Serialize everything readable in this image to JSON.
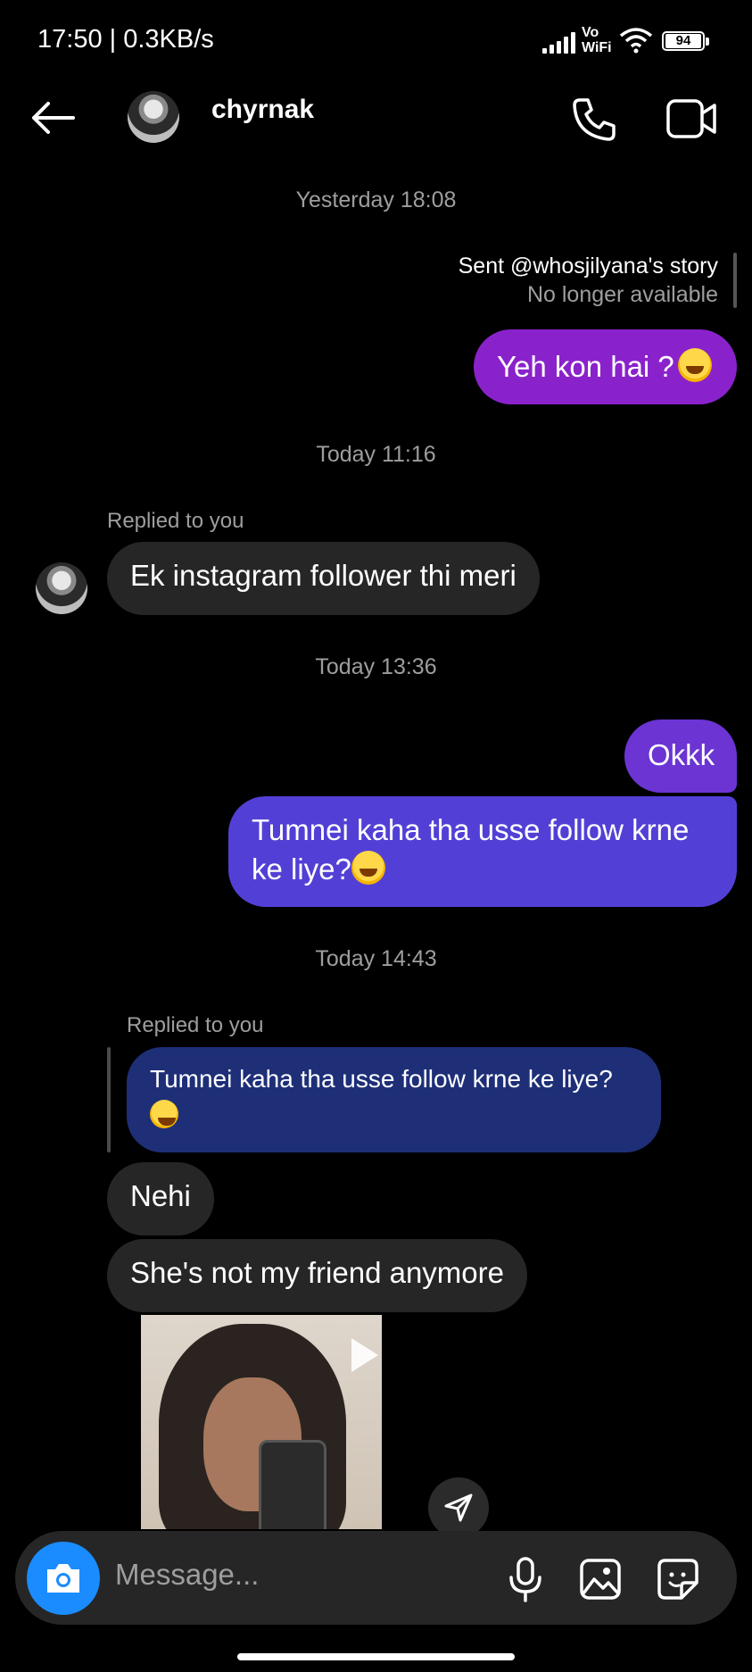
{
  "status_bar": {
    "time_speed": "17:50 | 0.3KB/s",
    "network_label_top": "Vo",
    "network_label_bottom": "WiFi",
    "battery": "94"
  },
  "header": {
    "username": "chyrnak"
  },
  "messages": {
    "ts1": "Yesterday 18:08",
    "story_sent": "Sent @whosjilyana's story",
    "story_status": "No longer available",
    "m1": "Yeh kon hai ?",
    "ts2": "Today 11:16",
    "replied1": "Replied to you",
    "m2": "Ek instagram follower thi meri",
    "ts3": "Today 13:36",
    "m3": "Okkk",
    "m4_line1": "Tumnei kaha tha usse follow krne",
    "m4_line2": "ke liye?",
    "ts4": "Today 14:43",
    "replied2": "Replied to you",
    "quote_line1": "Tumnei kaha tha usse follow krne ke liye?",
    "m5": "Nehi",
    "m6": "She's not my friend anymore"
  },
  "composer": {
    "placeholder": "Message..."
  },
  "colors": {
    "sent_purple": "#8a22cc",
    "sent_indigo": "#5b3bd6",
    "quote_blue": "#1e2f78",
    "received_gray": "#262626",
    "camera_blue": "#1a8cff"
  }
}
